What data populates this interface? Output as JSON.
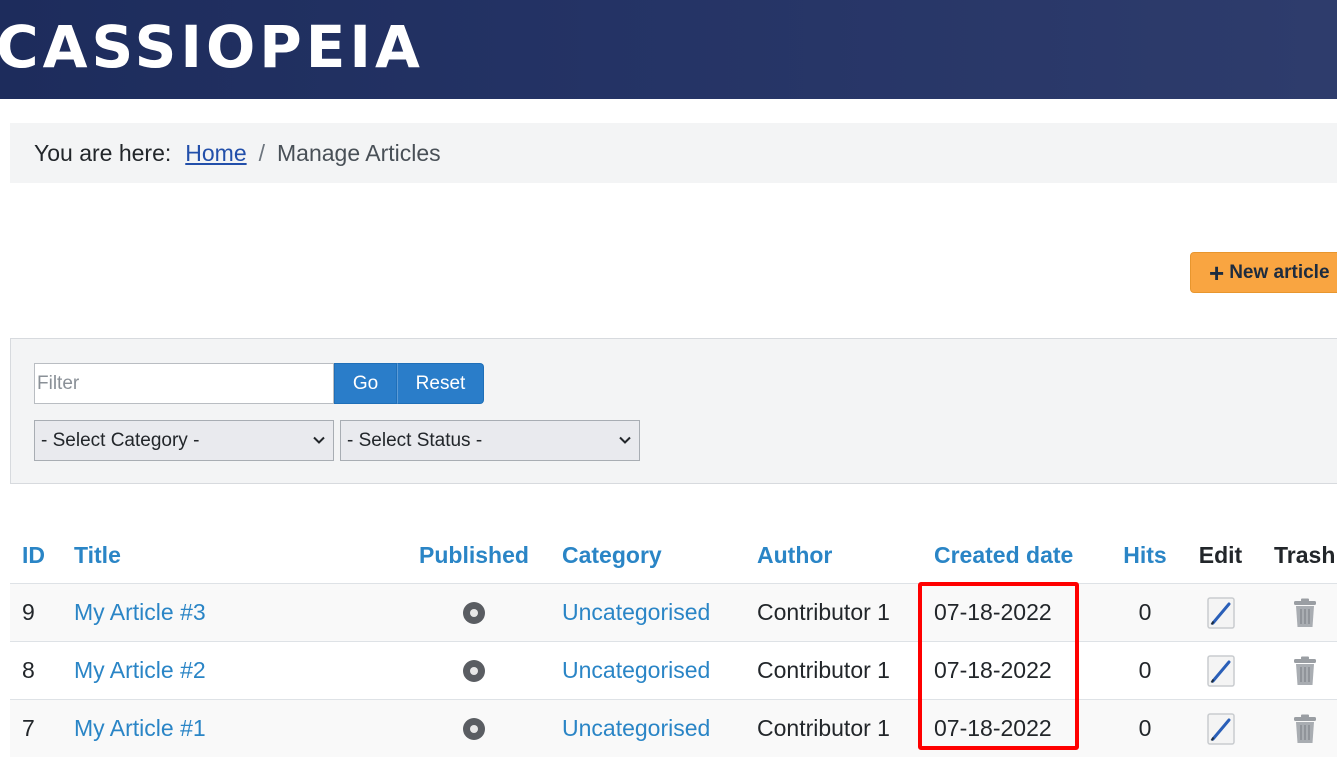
{
  "header": {
    "brand": "CASSIOPEIA"
  },
  "breadcrumb": {
    "lead": "You are here:",
    "home": "Home",
    "separator": "/",
    "current": "Manage Articles"
  },
  "toolbar": {
    "new_article_label": "New article",
    "new_article_icon": "plus-icon"
  },
  "filters": {
    "filter_placeholder": "Filter",
    "filter_value": "",
    "go_label": "Go",
    "reset_label": "Reset",
    "category_selected": "- Select Category -",
    "status_selected": "- Select Status -"
  },
  "table": {
    "columns": {
      "id": "ID",
      "title": "Title",
      "published": "Published",
      "category": "Category",
      "author": "Author",
      "created": "Created date",
      "hits": "Hits",
      "edit": "Edit",
      "trash": "Trash"
    },
    "rows": [
      {
        "id": "9",
        "title": "My Article #3",
        "category": "Uncategorised",
        "author": "Contributor 1",
        "created": "07-18-2022",
        "hits": "0"
      },
      {
        "id": "8",
        "title": "My Article #2",
        "category": "Uncategorised",
        "author": "Contributor 1",
        "created": "07-18-2022",
        "hits": "0"
      },
      {
        "id": "7",
        "title": "My Article #1",
        "category": "Uncategorised",
        "author": "Contributor 1",
        "created": "07-18-2022",
        "hits": "0"
      }
    ]
  },
  "colors": {
    "header_bg": "#1d2c5c",
    "link": "#2a85c6",
    "primary_button": "#2a7dc9",
    "new_button": "#f9a541",
    "highlight": "#ff0000"
  }
}
